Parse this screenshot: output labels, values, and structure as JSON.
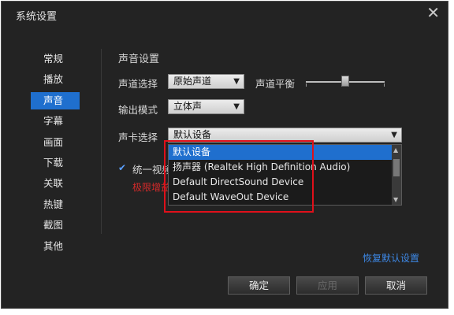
{
  "window": {
    "title": "系统设置",
    "close_glyph": "✕"
  },
  "sidebar": {
    "items": [
      {
        "label": "常规"
      },
      {
        "label": "播放"
      },
      {
        "label": "声音",
        "active": true
      },
      {
        "label": "字幕"
      },
      {
        "label": "画面"
      },
      {
        "label": "下载"
      },
      {
        "label": "关联"
      },
      {
        "label": "热键"
      },
      {
        "label": "截图"
      },
      {
        "label": "其他"
      }
    ]
  },
  "sound": {
    "section_title": "声音设置",
    "channel_label": "声道选择",
    "channel_value": "原始声道",
    "balance_label": "声道平衡",
    "balance_level": 0.5,
    "output_label": "输出模式",
    "output_value": "立体声",
    "card_label": "声卡选择",
    "card_value": "默认设备",
    "unify_label": "统一视频",
    "unify_checked": true,
    "warning_text": "极限增益"
  },
  "dropdown": {
    "options": [
      "默认设备",
      "扬声器 (Realtek High Definition Audio)",
      "Default DirectSound Device",
      "Default WaveOut Device"
    ],
    "selected_index": 0
  },
  "footer": {
    "restore_label": "恢复默认设置",
    "ok_label": "确定",
    "apply_label": "应用",
    "cancel_label": "取消"
  },
  "colors": {
    "accent": "#1f6fce",
    "highlight": "#e0101a",
    "warning": "#d42a2a",
    "link": "#3d88e6"
  }
}
